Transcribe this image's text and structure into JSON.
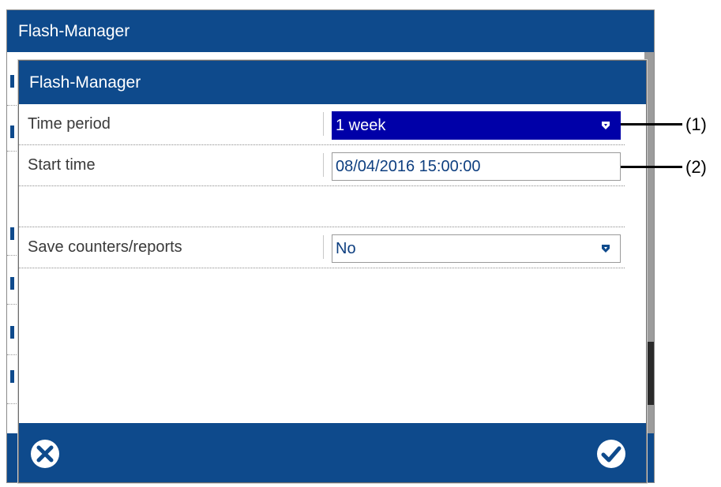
{
  "background_window": {
    "title": "Flash-Manager"
  },
  "dialog": {
    "title": "Flash-Manager",
    "rows": [
      {
        "label": "Time period",
        "value": "1 week",
        "type": "dropdown"
      },
      {
        "label": "Start time",
        "value": "08/04/2016 15:00:00",
        "type": "text"
      },
      {
        "label": "Save counters/reports",
        "value": "No",
        "type": "dropdown"
      }
    ],
    "cancel_icon": "close-circle-icon",
    "confirm_icon": "check-circle-icon"
  },
  "callouts": [
    "(1)",
    "(2)"
  ],
  "colors": {
    "titlebar": "#0e4a8c",
    "selected_field": "#0000a8",
    "field_text": "#0e3f80"
  }
}
